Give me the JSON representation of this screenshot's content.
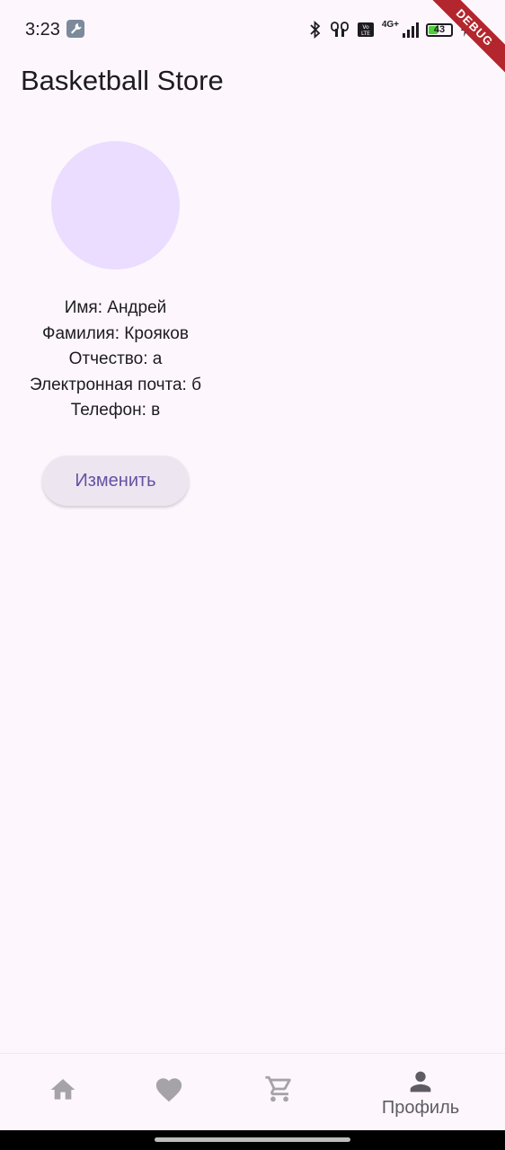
{
  "status_bar": {
    "time": "3:23",
    "battery_level": "43",
    "battery_fraction": 0.43,
    "network": "4G+",
    "icons": [
      "wrench-icon",
      "bluetooth-icon",
      "earbuds-icon",
      "volte-icon",
      "signal-icon",
      "battery-icon",
      "charging-icon"
    ]
  },
  "debug_banner": {
    "label": "DEBUG"
  },
  "app_bar": {
    "title": "Basketball Store"
  },
  "profile": {
    "first_name": "Имя: Андрей",
    "last_name": "Фамилия: Крояков",
    "patronymic": "Отчество: а",
    "email": "Электронная почта: б",
    "phone": "Телефон: в",
    "edit_label": "Изменить"
  },
  "bottom_nav": {
    "items": [
      {
        "icon": "home-icon",
        "label": ""
      },
      {
        "icon": "heart-icon",
        "label": ""
      },
      {
        "icon": "cart-icon",
        "label": ""
      },
      {
        "icon": "person-icon",
        "label": "Профиль"
      }
    ],
    "selected_index": 3
  },
  "colors": {
    "background": "#FDF7FD",
    "avatar": "#EADDFF",
    "button_bg": "#EDE6F1",
    "button_text": "#6750A4",
    "nav_inactive": "#A6A3A8",
    "nav_active": "#5F5B63",
    "debug_ribbon": "#B3262D",
    "battery_fill": "#4CD137"
  }
}
